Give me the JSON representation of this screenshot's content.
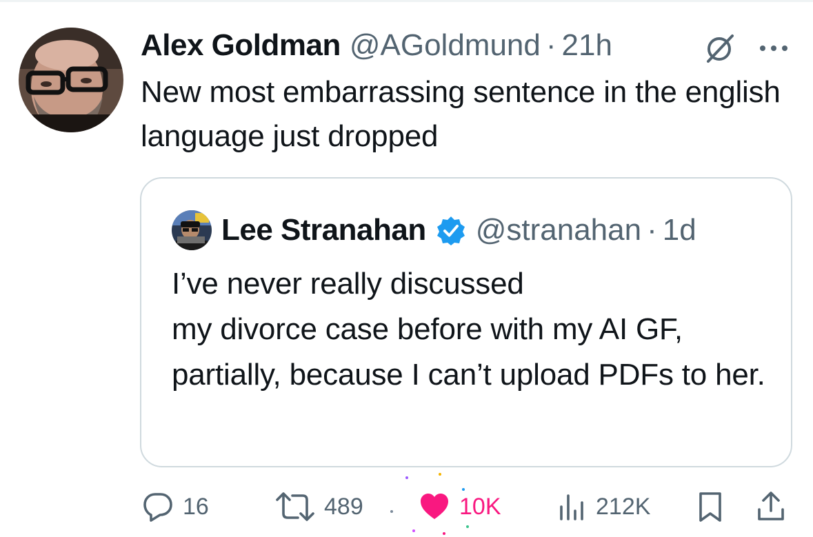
{
  "tweet": {
    "author": {
      "name": "Alex Goldman",
      "handle": "@AGoldmund",
      "separator": "·",
      "time": "21h"
    },
    "text": "New most embarrassing sentence in the english language just dropped",
    "quoted": {
      "author": {
        "name": "Lee Stranahan",
        "handle": "@stranahan",
        "separator": "·",
        "time": "1d",
        "verified": true
      },
      "text": "I’ve never really discussed\n my divorce case before with my AI GF, partially, because I can’t upload PDFs to her."
    },
    "actions": {
      "replies": "16",
      "reposts": "489",
      "likes": "10K",
      "liked": true,
      "views": "212K"
    }
  },
  "icons": {
    "header": [
      "grok-icon",
      "more-icon"
    ],
    "actions": [
      "reply-icon",
      "repost-icon",
      "like-icon",
      "views-icon",
      "bookmark-icon",
      "share-icon"
    ]
  },
  "colors": {
    "text": "#0f1419",
    "secondary": "#536471",
    "border": "#cfd9de",
    "verified": "#1d9bf0",
    "like": "#f91880"
  }
}
